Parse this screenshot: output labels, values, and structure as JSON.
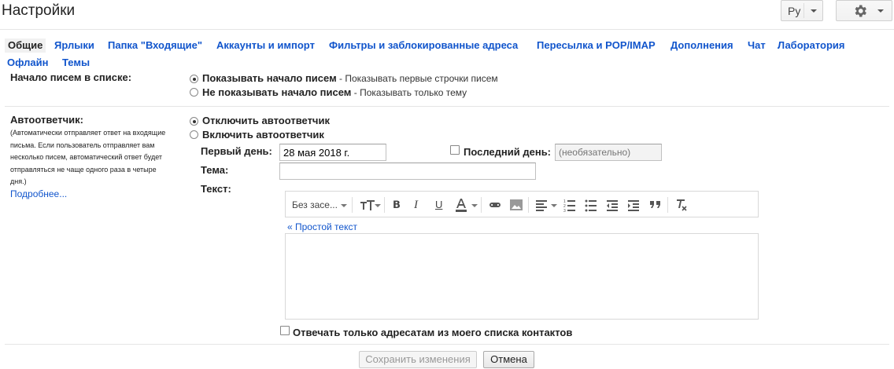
{
  "header": {
    "title": "Настройки",
    "lang_label": "Ру"
  },
  "tabs": [
    {
      "label": "Общие",
      "active": true
    },
    {
      "label": "Ярлыки"
    },
    {
      "label": "Папка \"Входящие\""
    },
    {
      "label": "Аккаунты и импорт"
    },
    {
      "label": "Фильтры и заблокированные адреса"
    },
    {
      "label": "Пересылка и POP/IMAP"
    },
    {
      "label": "Дополнения"
    },
    {
      "label": "Чат"
    },
    {
      "label": "Лаборатория"
    },
    {
      "label": "Офлайн"
    },
    {
      "label": "Темы"
    }
  ],
  "snippets": {
    "label": "Начало писем в списке:",
    "option1_bold": "Показывать начало писем",
    "option1_desc": " - Показывать первые строчки писем",
    "option2_bold": "Не показывать начало писем",
    "option2_desc": " - Показывать только тему",
    "selected": 1
  },
  "vacation": {
    "label": "Автоответчик:",
    "desc_lines": [
      "(Автоматически отправляет ответ на входящие",
      "письма. Если пользователь отправляет вам",
      "несколько писем, автоматический ответ будет",
      "отправляться не чаще одного раза в четыре",
      "дня.)"
    ],
    "more_link": "Подробнее...",
    "off_label": "Отключить автоответчик",
    "on_label": "Включить автоответчик",
    "selected": 1,
    "first_day_label": "Первый день:",
    "first_day_value": "28 мая 2018 г.",
    "last_day_label": "Последний день:",
    "last_day_placeholder": "(необязательно)",
    "subject_label": "Тема:",
    "subject_value": "",
    "text_label": "Текст:",
    "font_label": "Без засе...",
    "plain_text_link": "« Простой текст",
    "contacts_only_label": "Отвечать только адресатам из моего списка контактов"
  },
  "footer": {
    "save_label": "Сохранить изменения",
    "cancel_label": "Отмена"
  },
  "colors": {
    "link": "#1155cc",
    "text": "#222222",
    "border": "#d8d8d8"
  }
}
